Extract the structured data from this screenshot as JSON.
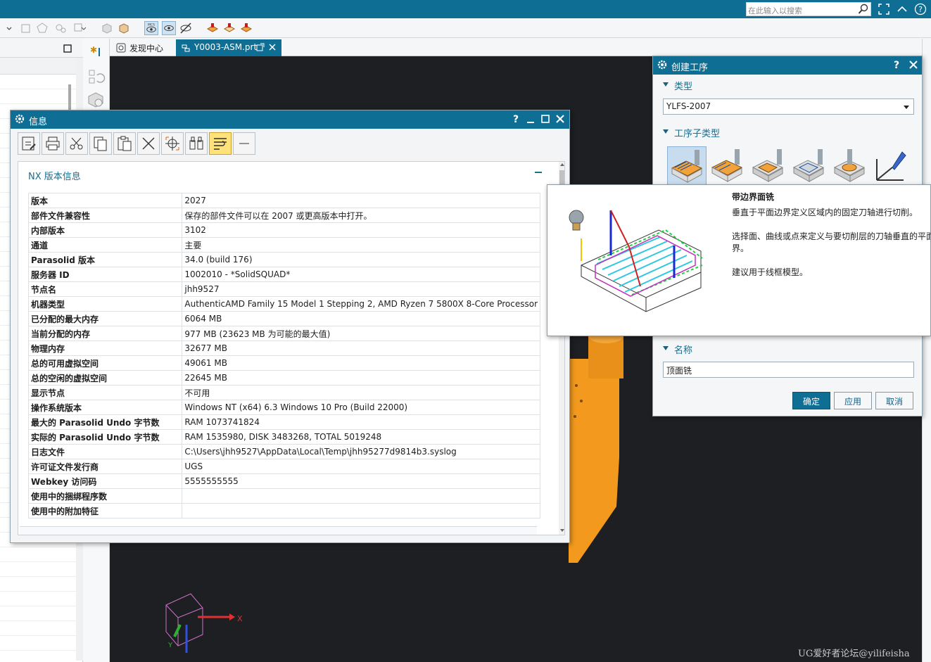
{
  "search": {
    "placeholder": "在此输入以搜索"
  },
  "tabs": {
    "discovery": "发现中心",
    "part": "Y0003-ASM.prt"
  },
  "info_dialog": {
    "title": "信息",
    "section_title": "NX 版本信息",
    "rows": [
      {
        "key": "版本",
        "value": "2027"
      },
      {
        "key": "部件文件兼容性",
        "value": "保存的部件文件可以在 2007 或更高版本中打开。"
      },
      {
        "key": "内部版本",
        "value": "3102"
      },
      {
        "key": "通道",
        "value": "主要"
      },
      {
        "key": "Parasolid 版本",
        "value": "34.0 (build 176)"
      },
      {
        "key": "服务器 ID",
        "value": "1002010 - *SolidSQUAD*"
      },
      {
        "key": "节点名",
        "value": "jhh9527"
      },
      {
        "key": "机器类型",
        "value": "AuthenticAMD Family 15 Model 1 Stepping 2, AMD Ryzen 7 5800X 8-Core Processor"
      },
      {
        "key": "已分配的最大内存",
        "value": "6064 MB"
      },
      {
        "key": "当前分配的内存",
        "value": "977 MB (23623 MB 为可能的最大值)"
      },
      {
        "key": "物理内存",
        "value": "32677 MB"
      },
      {
        "key": "总的可用虚拟空间",
        "value": "49061 MB"
      },
      {
        "key": "总的空闲的虚拟空间",
        "value": "22645 MB"
      },
      {
        "key": "显示节点",
        "value": "不可用"
      },
      {
        "key": "操作系统版本",
        "value": "Windows NT (x64) 6.3 Windows 10 Pro (Build 22000)"
      },
      {
        "key": "最大的 Parasolid Undo 字节数",
        "value": "RAM 1073741824"
      },
      {
        "key": "实际的 Parasolid Undo 字节数",
        "value": "RAM 1535980, DISK 3483268, TOTAL 5019248"
      },
      {
        "key": "日志文件",
        "value": "C:\\Users\\jhh9527\\AppData\\Local\\Temp\\jhh95277d9814b3.syslog"
      },
      {
        "key": "许可证文件发行商",
        "value": "UGS"
      },
      {
        "key": "Webkey 访问码",
        "value": "5555555555"
      },
      {
        "key": "使用中的捆绑程序数",
        "value": ""
      },
      {
        "key": "使用中的附加特征",
        "value": ""
      }
    ]
  },
  "op_dialog": {
    "title": "创建工序",
    "type_label": "类型",
    "type_value": "YLFS-2007",
    "subtype_label": "工序子类型",
    "name_label": "名称",
    "name_value": "顶面铣",
    "ok": "确定",
    "apply": "应用",
    "cancel": "取消"
  },
  "tooltip": {
    "title": "带边界面铣",
    "line1": "垂直于平面边界定义区域内的固定刀轴进行切削。",
    "line2": "选择面、曲线或点来定义与要切削层的刀轴垂直的平面边",
    "line3": "界。",
    "line4": "建议用于线框模型。"
  },
  "viewport": {
    "axis_x": "X",
    "axis_y": "Y"
  },
  "watermark": "UG爱好者论坛@yilifeisha",
  "colors": {
    "accent": "#0f6e94",
    "viewport_bg": "#1d1f23",
    "model_orange": "#f39a1e"
  }
}
